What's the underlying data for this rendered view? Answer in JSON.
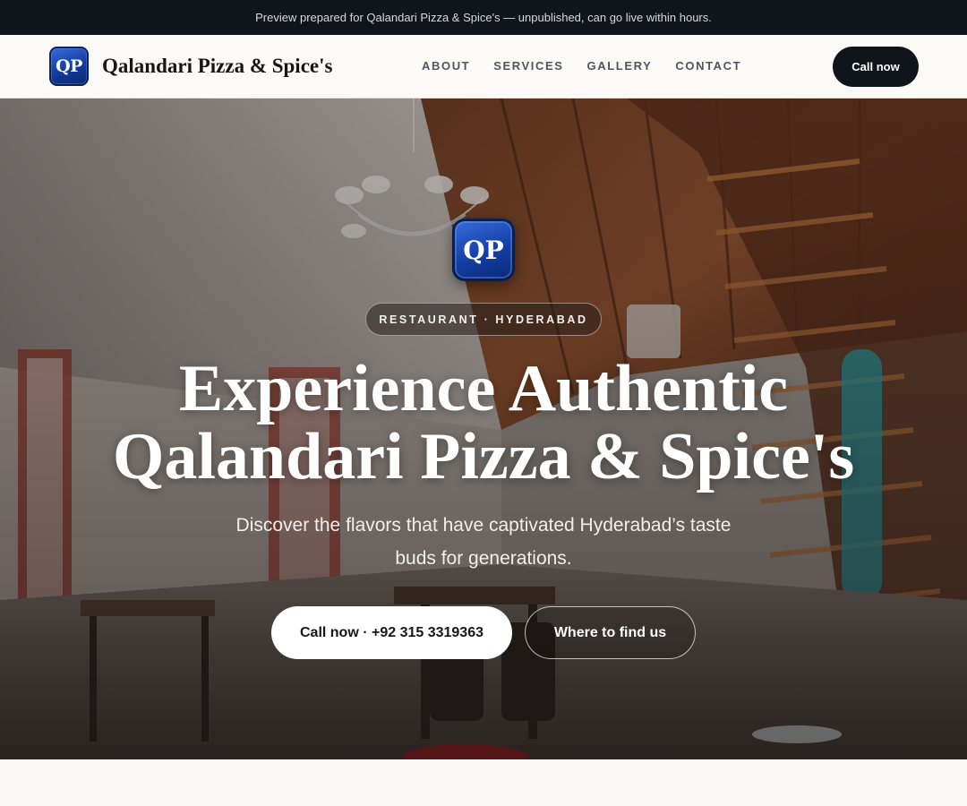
{
  "banner": {
    "text": "Preview prepared for Qalandari Pizza & Spice's — unpublished, can go live within hours."
  },
  "header": {
    "logo_text": "QP",
    "brand_name": "Qalandari Pizza & Spice's",
    "nav": [
      {
        "label": "ABOUT"
      },
      {
        "label": "SERVICES"
      },
      {
        "label": "GALLERY"
      },
      {
        "label": "CONTACT"
      }
    ],
    "cta_label": "Call now"
  },
  "hero": {
    "logo_text": "QP",
    "tag": "RESTAURANT · HYDERABAD",
    "title_line1": "Experience Authentic",
    "title_line2": "Qalandari Pizza & Spice's",
    "subtitle": "Discover the flavors that have captivated Hyderabad’s taste buds for generations.",
    "primary_button": "Call now · +92 315 3319363",
    "secondary_button": "Where to find us"
  },
  "colors": {
    "banner_bg": "#10141b",
    "dark_button": "#10141b",
    "logo_blue": "#143ea5",
    "page_bg": "#faf8f5"
  }
}
